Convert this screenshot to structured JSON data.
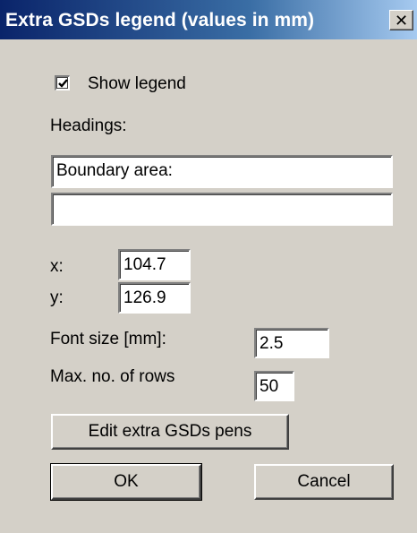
{
  "window": {
    "title": "Extra GSDs legend (values in mm)",
    "close_glyph": "✕"
  },
  "show_legend": {
    "label": "Show legend",
    "checked": true
  },
  "headings": {
    "label": "Headings:",
    "line1": "Boundary area:",
    "line2": ""
  },
  "x": {
    "label": "x:",
    "value": "104.7"
  },
  "y": {
    "label": "y:",
    "value": "126.9"
  },
  "font_size": {
    "label": "Font size [mm]:",
    "value": "2.5"
  },
  "max_rows": {
    "label": "Max. no. of rows",
    "value": "50"
  },
  "buttons": {
    "edit_pens": "Edit extra GSDs pens",
    "ok": "OK",
    "cancel": "Cancel"
  },
  "icons": {
    "close": "close-icon",
    "check": "check-icon"
  }
}
